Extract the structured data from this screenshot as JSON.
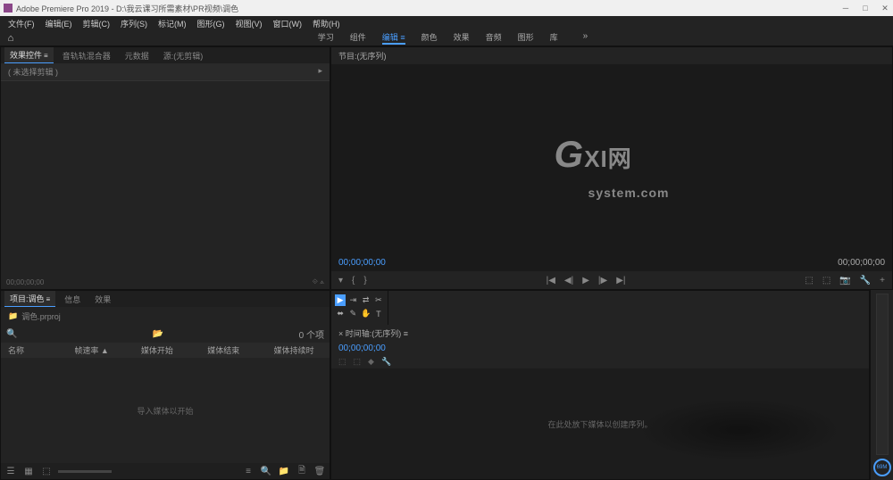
{
  "titlebar": {
    "title": "Adobe Premiere Pro 2019 - D:\\我云课习所需素材\\PR视频\\调色"
  },
  "menubar": [
    "文件(F)",
    "编辑(E)",
    "剪辑(C)",
    "序列(S)",
    "标记(M)",
    "图形(G)",
    "视图(V)",
    "窗口(W)",
    "帮助(H)"
  ],
  "workspaces": {
    "tabs": [
      "学习",
      "组件",
      "编辑",
      "颜色",
      "效果",
      "音频",
      "图形",
      "库"
    ],
    "active": 2,
    "more": "»"
  },
  "effect_controls": {
    "tabs": [
      "效果控件",
      "音轨轨混合器",
      "元数据",
      "源:(无剪辑)"
    ],
    "selection": "( 未选择剪辑 )",
    "timecode": "00;00;00;00"
  },
  "program": {
    "header": "节目:(无序列)",
    "watermark_big": "G",
    "watermark_top": "XI网",
    "watermark_bottom": "system.com",
    "tc_left": "00;00;00;00",
    "tc_right": "00;00;00;00"
  },
  "project": {
    "tabs": [
      "项目:调色",
      "信息",
      "效果"
    ],
    "name": "调色.prproj",
    "count": "0 个项",
    "headers": [
      "名称",
      "帧速率 ▲",
      "媒体开始",
      "媒体结束",
      "媒体持续时"
    ],
    "empty": "导入媒体以开始"
  },
  "timeline": {
    "header": "× 时间轴:(无序列) ≡",
    "timecode": "00;00;00;00",
    "empty": "在此处放下媒体以创建序列。"
  },
  "meter": {
    "label": "69M"
  }
}
